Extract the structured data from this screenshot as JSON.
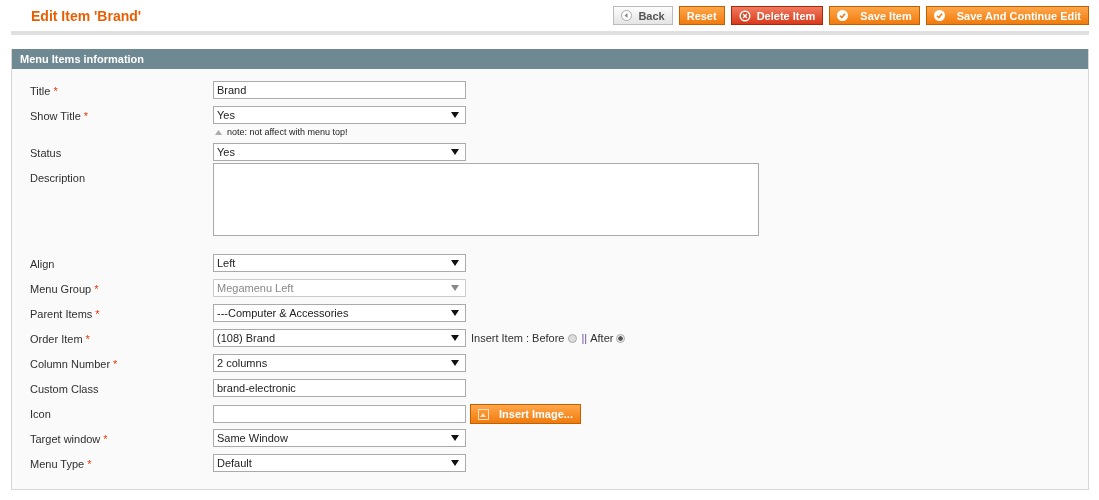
{
  "page_title": "Edit Item 'Brand'",
  "buttons": [
    {
      "label": "Back",
      "kind": "back"
    },
    {
      "label": "Reset",
      "kind": "plain"
    },
    {
      "label": "Delete Item",
      "kind": "delete"
    },
    {
      "label": "Save Item",
      "kind": "save"
    },
    {
      "label": "Save And Continue Edit",
      "kind": "save"
    }
  ],
  "section": {
    "title": "Menu Items information",
    "fields": [
      {
        "label": "Title",
        "required_mark": "*",
        "kind": "text",
        "value": "Brand"
      },
      {
        "label": "Show Title",
        "required_mark": "*",
        "kind": "select",
        "value": "Yes",
        "disabled": false,
        "note": "note: not affect with menu top!"
      },
      {
        "label": "Status",
        "kind": "select",
        "value": "Yes",
        "disabled": false
      },
      {
        "label": "Description",
        "kind": "textarea"
      },
      {
        "label": "Align",
        "kind": "select",
        "value": "Left",
        "disabled": false
      },
      {
        "label": "Menu Group",
        "required_mark": "*",
        "kind": "select",
        "value": "Megamenu Left",
        "disabled": true
      },
      {
        "label": "Parent Items",
        "required_mark": "*",
        "kind": "select",
        "value": "---Computer & Accessories",
        "disabled": false
      },
      {
        "label": "Order Item",
        "required_mark": "*",
        "kind": "select",
        "value": "(108) Brand",
        "disabled": false,
        "insert": {
          "label": "Insert Item :",
          "options": [
            {
              "label": "Before",
              "selected": false
            },
            {
              "label": "After",
              "selected": true
            }
          ],
          "separator": "||"
        }
      },
      {
        "label": "Column Number",
        "required_mark": "*",
        "kind": "select",
        "value": "2 columns",
        "disabled": false
      },
      {
        "label": "Custom Class",
        "kind": "text",
        "value": "brand-electronic"
      },
      {
        "label": "Icon",
        "kind": "file",
        "button": "Insert Image..."
      },
      {
        "label": "Target window",
        "required_mark": "*",
        "kind": "select",
        "value": "Same Window",
        "disabled": false
      },
      {
        "label": "Menu Type",
        "required_mark": "*",
        "kind": "select",
        "value": "Default",
        "disabled": false
      }
    ]
  }
}
